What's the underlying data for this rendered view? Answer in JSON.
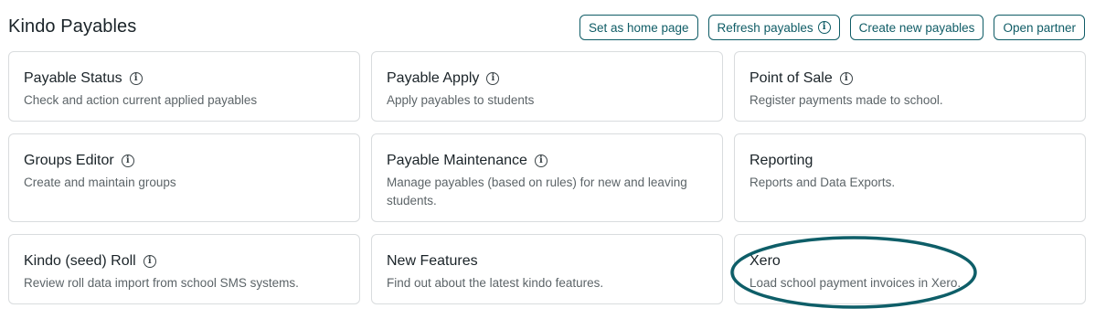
{
  "header": {
    "title": "Kindo Payables"
  },
  "actions": {
    "set_home": "Set as home page",
    "refresh": "Refresh payables",
    "create": "Create new payables",
    "open_partner": "Open partner"
  },
  "tiles": [
    {
      "title": "Payable Status",
      "desc": "Check and action current applied payables",
      "info": true
    },
    {
      "title": "Payable Apply",
      "desc": "Apply payables to students",
      "info": true
    },
    {
      "title": "Point of Sale",
      "desc": "Register payments made to school.",
      "info": true
    },
    {
      "title": "Groups Editor",
      "desc": "Create and maintain groups",
      "info": true
    },
    {
      "title": "Payable Maintenance",
      "desc": "Manage payables (based on rules) for new and leaving students.",
      "info": true
    },
    {
      "title": "Reporting",
      "desc": "Reports and Data Exports.",
      "info": false
    },
    {
      "title": "Kindo (seed) Roll",
      "desc": "Review roll data import from school SMS systems.",
      "info": true
    },
    {
      "title": "New Features",
      "desc": "Find out about the latest kindo features.",
      "info": false
    },
    {
      "title": "Xero",
      "desc": "Load school payment invoices in Xero.",
      "info": false
    }
  ],
  "icons": {
    "info": "info-circle-icon"
  },
  "colors": {
    "accent": "#0f5c66",
    "highlight_ring": "#0e5e68"
  }
}
